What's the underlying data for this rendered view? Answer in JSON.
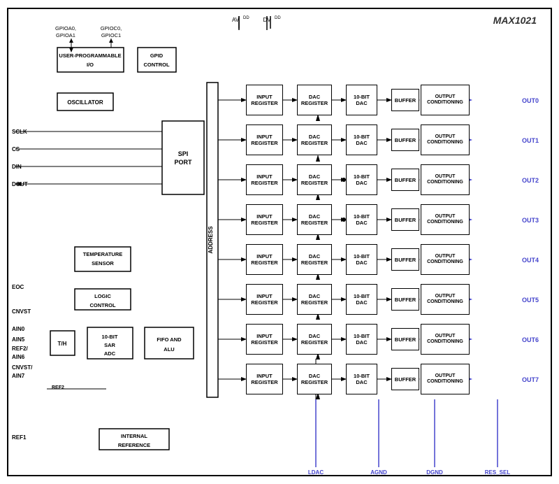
{
  "chip": {
    "title": "MAX1021"
  },
  "signals": {
    "left": [
      "SCLK",
      "CS",
      "DIN",
      "DOUT",
      "EOC",
      "CNVST",
      "AIN0",
      "AIN5",
      "REF2/",
      "AIN6",
      "CNVST/",
      "AIN7",
      "REF1"
    ],
    "gpio_top": [
      "GPIOA0,",
      "GPIOA1",
      "GPIOC0,",
      "GPIOC1"
    ],
    "power": [
      "AVDD",
      "DVDD"
    ],
    "bottom": [
      "LDAC",
      "AGND",
      "DGND",
      "RES_SEL"
    ],
    "outputs": [
      "OUT0",
      "OUT1",
      "OUT2",
      "OUT3",
      "OUT4",
      "OUT5",
      "OUT6",
      "OUT7"
    ]
  },
  "blocks": {
    "user_prog": "USER-PROGRAMMABLE\nI/O",
    "gpio_ctrl": "GPID\nCONTROL",
    "oscillator": "OSCILLATOR",
    "spi_port": "SPI\nPORT",
    "temp_sensor": "TEMPERATURE\nSENSOR",
    "logic_ctrl": "LOGIC\nCONTROL",
    "sar_adc": "10-BIT\nSAR\nADC",
    "th": "T/H",
    "fifo_alu": "FIFO AND\nALU",
    "internal_ref": "INTERNAL\nREFERENCE",
    "input_reg": "INPUT\nREGISTER",
    "dac_reg": "DAC\nREGISTER",
    "ten_bit_dac": "10-BIT\nDAC",
    "buffer": "BUFFER",
    "out_cond": "OUTPUT\nCONDITIONING",
    "address": "ADDRESS"
  }
}
